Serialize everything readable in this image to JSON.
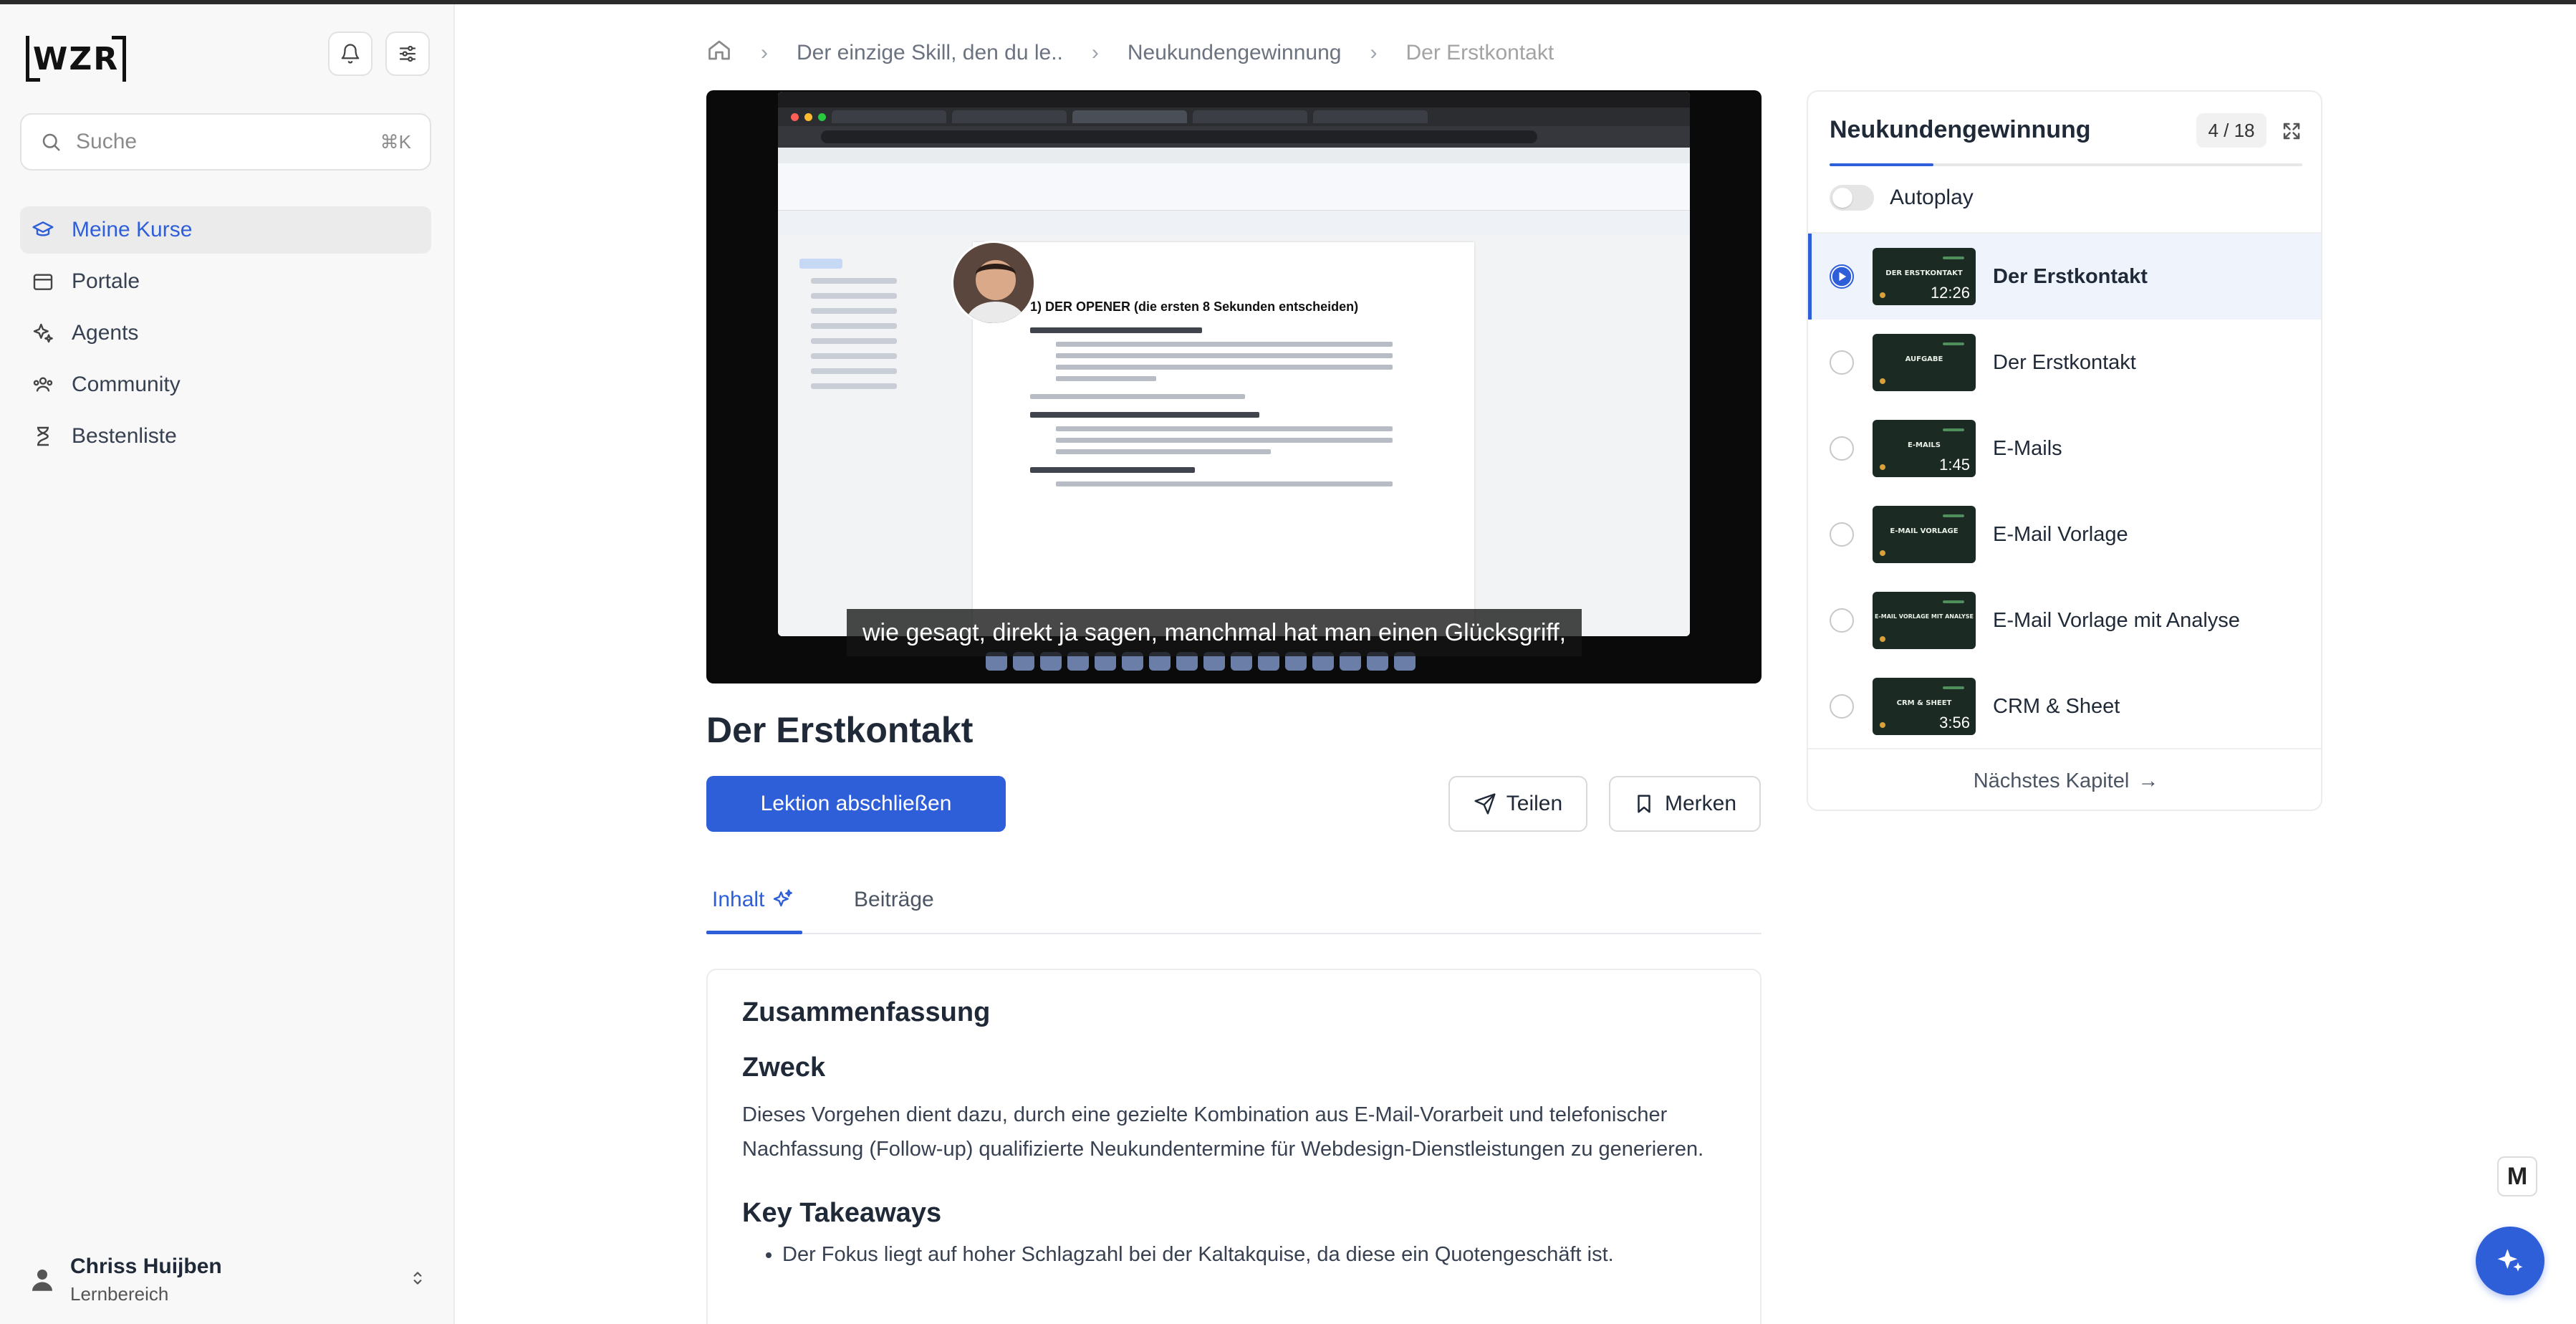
{
  "sidebar": {
    "logo_text": "WZR",
    "search": {
      "placeholder": "Suche",
      "shortcut": "⌘K"
    },
    "nav": [
      {
        "label": "Meine Kurse",
        "icon": "graduation-cap-icon",
        "active": true
      },
      {
        "label": "Portale",
        "icon": "archive-icon",
        "active": false
      },
      {
        "label": "Agents",
        "icon": "sparkles-icon",
        "active": false
      },
      {
        "label": "Community",
        "icon": "users-icon",
        "active": false
      },
      {
        "label": "Bestenliste",
        "icon": "hourglass-icon",
        "active": false
      }
    ],
    "user": {
      "name": "Chriss Huijben",
      "role": "Lernbereich"
    }
  },
  "breadcrumb": {
    "items": [
      "Der einzige Skill, den du le..",
      "Neukundengewinnung",
      "Der Erstkontakt"
    ]
  },
  "video": {
    "caption": "wie gesagt, direkt ja sagen, manchmal hat man einen Glücksgriff,",
    "doc_heading": "1) DER OPENER (die ersten 8 Sekunden entscheiden)"
  },
  "lesson": {
    "title": "Der Erstkontakt",
    "complete_label": "Lektion abschließen",
    "share_label": "Teilen",
    "save_label": "Merken"
  },
  "tabs": [
    {
      "label": "Inhalt",
      "active": true
    },
    {
      "label": "Beiträge",
      "active": false
    }
  ],
  "summary": {
    "heading": "Zusammenfassung",
    "purpose_heading": "Zweck",
    "purpose_text": "Dieses Vorgehen dient dazu, durch eine gezielte Kombination aus E-Mail-Vorarbeit und telefonischer Nachfassung (Follow-up) qualifizierte Neukundentermine für Webdesign-Dienstleistungen zu generieren.",
    "takeaways_heading": "Key Takeaways",
    "takeaways": [
      "Der Fokus liegt auf hoher Schlagzahl bei der Kaltakquise, da diese ein Quotengeschäft ist."
    ]
  },
  "panel": {
    "title": "Neukundengewinnung",
    "counter": "4 / 18",
    "progress_fraction": 0.22,
    "autoplay_label": "Autoplay",
    "autoplay_on": false,
    "chapters": [
      {
        "label": "Der Erstkontakt",
        "thumb": "DER ERSTKONTAKT",
        "duration": "12:26",
        "active": true
      },
      {
        "label": "Der Erstkontakt",
        "thumb": "AUFGABE",
        "duration": "",
        "active": false
      },
      {
        "label": "E-Mails",
        "thumb": "E-MAILS",
        "duration": "1:45",
        "active": false
      },
      {
        "label": "E-Mail Vorlage",
        "thumb": "E-MAIL VORLAGE",
        "duration": "",
        "active": false
      },
      {
        "label": "E-Mail Vorlage mit Analyse",
        "thumb": "E-MAIL VORLAGE MIT ANALYSE",
        "duration": "",
        "active": false
      },
      {
        "label": "CRM & Sheet",
        "thumb": "CRM & SHEET",
        "duration": "3:56",
        "active": false
      }
    ],
    "next_label": "Nächstes Kapitel",
    "next_arrow": "→"
  },
  "floating": {
    "badge": "M"
  },
  "colors": {
    "accent": "#2f5fd8",
    "active_bg": "#eef3fc"
  }
}
